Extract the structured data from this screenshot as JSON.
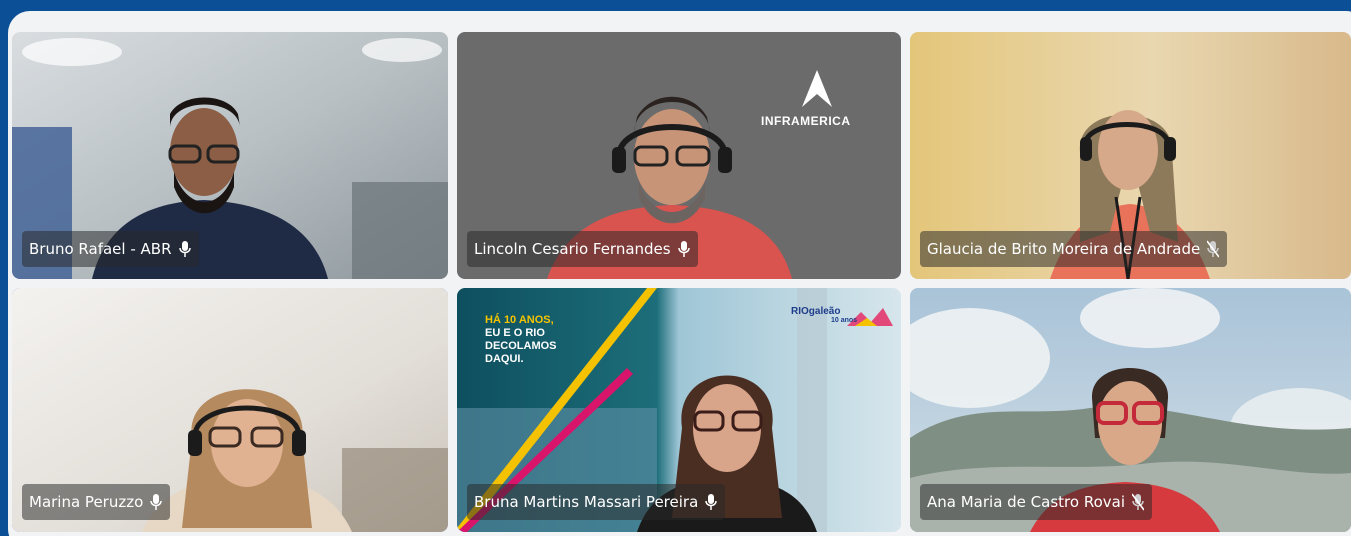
{
  "meeting": {
    "layout": "grid-3x2",
    "colors": {
      "outer_background": "#0b4f96",
      "panel_background": "#f2f3f5",
      "active_speaker_border": "#6a66c9",
      "name_tag_background": "rgba(40,40,40,0.52)"
    },
    "participants": [
      {
        "name": "Bruno Rafael - ABR",
        "mic_state": "on",
        "mic_icon": "microphone-icon"
      },
      {
        "name": "Lincoln Cesario Fernandes",
        "mic_state": "on",
        "mic_icon": "microphone-icon"
      },
      {
        "name": "Glaucia de Brito Moreira de Andrade",
        "mic_state": "muted",
        "mic_icon": "microphone-muted-icon"
      },
      {
        "name": "Marina Peruzzo",
        "mic_state": "on",
        "mic_icon": "microphone-icon",
        "active_speaker": true
      },
      {
        "name": "Bruna Martins Massari Pereira",
        "mic_state": "on",
        "mic_icon": "microphone-icon"
      },
      {
        "name": "Ana Maria de Castro Rovai",
        "mic_state": "muted",
        "mic_icon": "microphone-muted-icon"
      }
    ],
    "backgrounds": {
      "lincoln_logo": "INFRAMERICA",
      "bruna_banner": [
        "HÁ 10 ANOS,",
        "EU E O RIO",
        "DECOLAMOS",
        "DAQUI."
      ],
      "bruna_brand": "RIOgaleão",
      "bruna_brand_sub": "10 anos"
    }
  }
}
